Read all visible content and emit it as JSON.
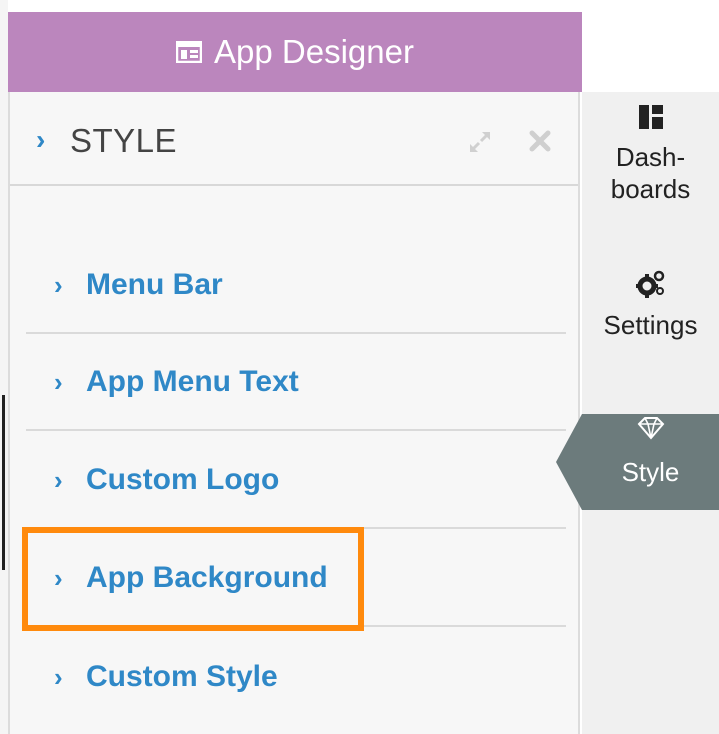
{
  "header": {
    "title": "App Designer",
    "icon": "app-layout-icon",
    "color": "#bb86bd"
  },
  "panel": {
    "title": "STYLE",
    "expand_icon": "expand-arrows-icon",
    "close_icon": "close-icon",
    "items": [
      {
        "label": "Menu Bar"
      },
      {
        "label": "App Menu Text"
      },
      {
        "label": "Custom Logo"
      },
      {
        "label": "App Background",
        "highlighted": true
      },
      {
        "label": "Custom Style"
      }
    ],
    "link_color": "#2f88c7",
    "highlight_color": "#ff8a0d"
  },
  "sidebar": {
    "items": [
      {
        "label_line1": "Dash-",
        "label_line2": "boards",
        "icon": "dashboards-icon"
      },
      {
        "label": "Settings",
        "icon": "gears-icon"
      },
      {
        "label": "Style",
        "icon": "diamond-icon",
        "active": true
      }
    ],
    "active_color": "#6c7b7c"
  }
}
